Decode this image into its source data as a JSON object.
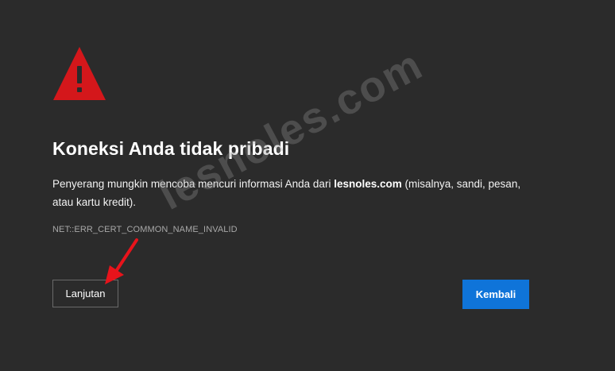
{
  "icons": {
    "warning": "warning-triangle-icon",
    "arrow": "red-arrow-annotation"
  },
  "colors": {
    "background": "#2b2b2b",
    "warning_red": "#d4171b",
    "primary_button": "#0f74d9",
    "annotation_red": "#e8131b"
  },
  "error": {
    "title": "Koneksi Anda tidak pribadi",
    "description_before": "Penyerang mungkin mencoba mencuri informasi Anda dari ",
    "domain": "lesnoles.com",
    "description_after": " (misalnya, sandi, pesan, atau kartu kredit).",
    "code": "NET::ERR_CERT_COMMON_NAME_INVALID"
  },
  "buttons": {
    "advanced_label": "Lanjutan",
    "back_label": "Kembali"
  },
  "watermark": {
    "text": "lesnoles.com"
  }
}
